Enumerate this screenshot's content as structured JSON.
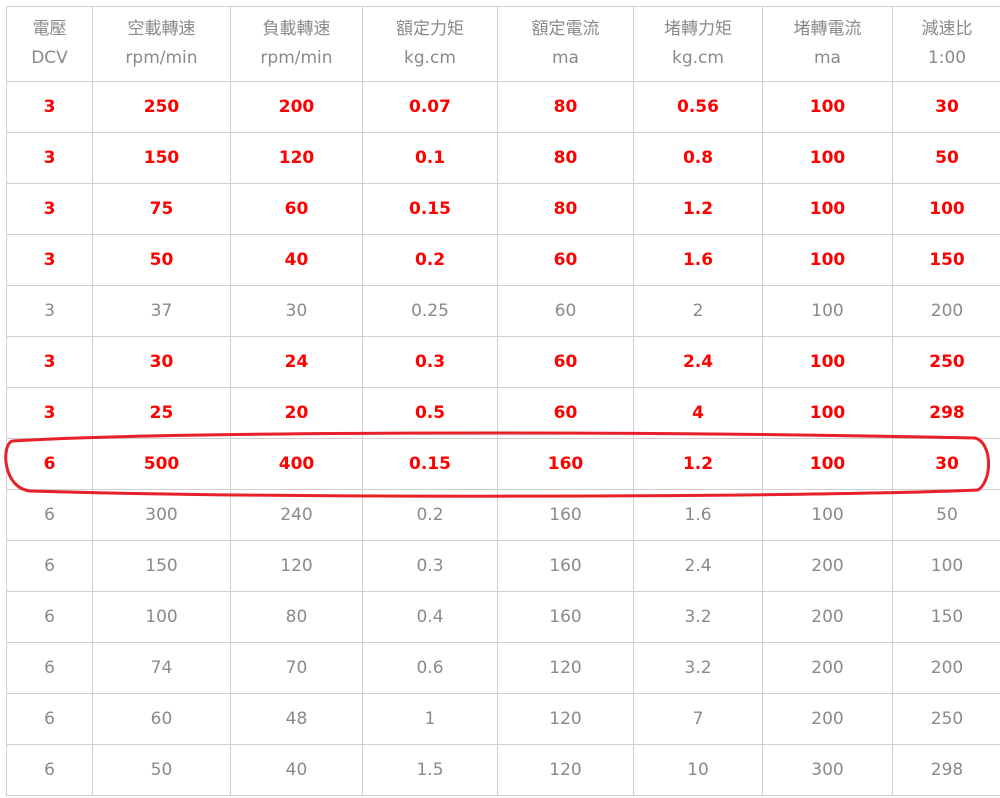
{
  "columns": [
    {
      "name": "電壓",
      "unit": "DCV"
    },
    {
      "name": "空載轉速",
      "unit": "rpm/min"
    },
    {
      "name": "負載轉速",
      "unit": "rpm/min"
    },
    {
      "name": "額定力矩",
      "unit": "kg.cm"
    },
    {
      "name": "額定電流",
      "unit": "ma"
    },
    {
      "name": "堵轉力矩",
      "unit": "kg.cm"
    },
    {
      "name": "堵轉電流",
      "unit": "ma"
    },
    {
      "name": "減速比",
      "unit": "1:00"
    }
  ],
  "rows": [
    {
      "highlight": true,
      "cells": [
        "3",
        "250",
        "200",
        "0.07",
        "80",
        "0.56",
        "100",
        "30"
      ]
    },
    {
      "highlight": true,
      "cells": [
        "3",
        "150",
        "120",
        "0.1",
        "80",
        "0.8",
        "100",
        "50"
      ]
    },
    {
      "highlight": true,
      "cells": [
        "3",
        "75",
        "60",
        "0.15",
        "80",
        "1.2",
        "100",
        "100"
      ]
    },
    {
      "highlight": true,
      "cells": [
        "3",
        "50",
        "40",
        "0.2",
        "60",
        "1.6",
        "100",
        "150"
      ]
    },
    {
      "highlight": false,
      "cells": [
        "3",
        "37",
        "30",
        "0.25",
        "60",
        "2",
        "100",
        "200"
      ]
    },
    {
      "highlight": true,
      "cells": [
        "3",
        "30",
        "24",
        "0.3",
        "60",
        "2.4",
        "100",
        "250"
      ]
    },
    {
      "highlight": true,
      "cells": [
        "3",
        "25",
        "20",
        "0.5",
        "60",
        "4",
        "100",
        "298"
      ]
    },
    {
      "highlight": true,
      "circled": true,
      "cells": [
        "6",
        "500",
        "400",
        "0.15",
        "160",
        "1.2",
        "100",
        "30"
      ]
    },
    {
      "highlight": false,
      "cells": [
        "6",
        "300",
        "240",
        "0.2",
        "160",
        "1.6",
        "100",
        "50"
      ]
    },
    {
      "highlight": false,
      "cells": [
        "6",
        "150",
        "120",
        "0.3",
        "160",
        "2.4",
        "200",
        "100"
      ]
    },
    {
      "highlight": false,
      "cells": [
        "6",
        "100",
        "80",
        "0.4",
        "160",
        "3.2",
        "200",
        "150"
      ]
    },
    {
      "highlight": false,
      "cells": [
        "6",
        "74",
        "70",
        "0.6",
        "120",
        "3.2",
        "200",
        "200"
      ]
    },
    {
      "highlight": false,
      "cells": [
        "6",
        "60",
        "48",
        "1",
        "120",
        "7",
        "200",
        "250"
      ]
    },
    {
      "highlight": false,
      "cells": [
        "6",
        "50",
        "40",
        "1.5",
        "120",
        "10",
        "300",
        "298"
      ]
    }
  ],
  "colors": {
    "highlight_text": "#ff0000",
    "normal_text": "#8a8a8a",
    "grid": "#cfcfcf",
    "annotation_oval": "#e8202a"
  }
}
